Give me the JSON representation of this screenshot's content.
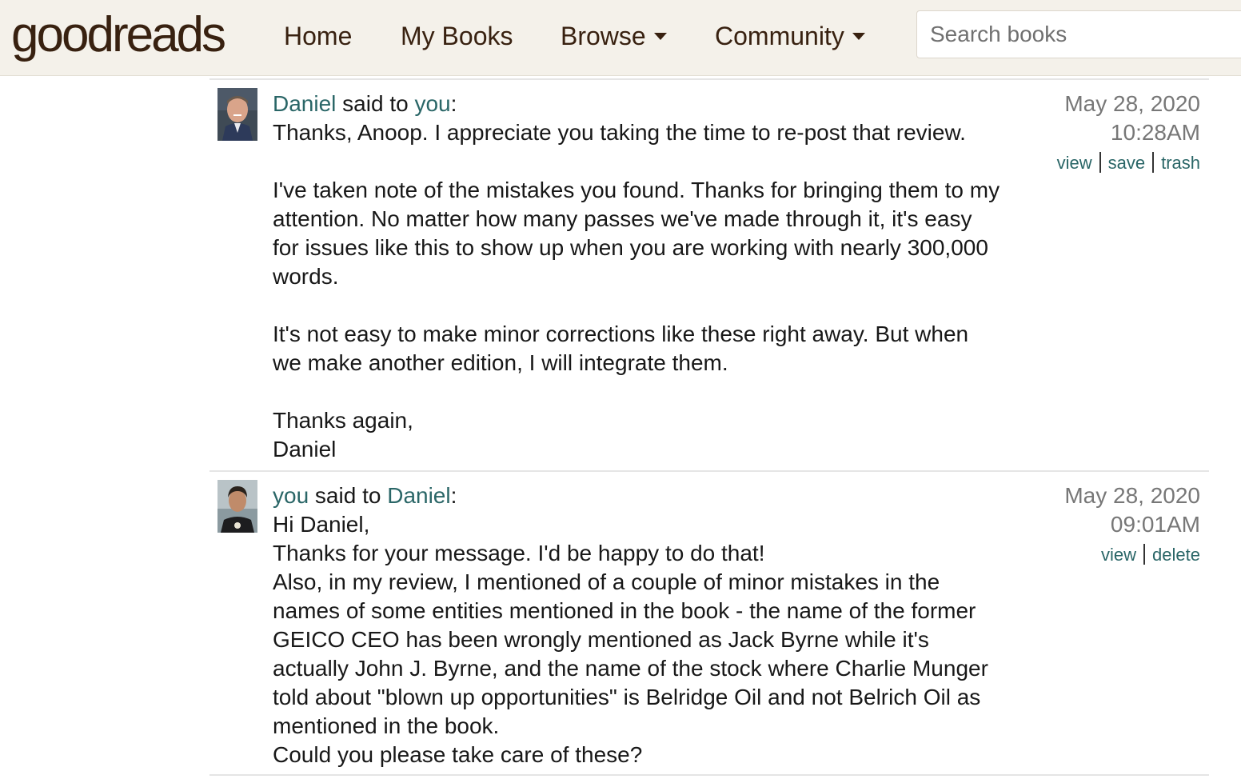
{
  "header": {
    "logo_light": "good",
    "logo_bold": "reads",
    "nav": {
      "home": "Home",
      "my_books": "My Books",
      "browse": "Browse",
      "community": "Community"
    },
    "search": {
      "placeholder": "Search books",
      "value": ""
    }
  },
  "messages": [
    {
      "from": "Daniel",
      "said_to": " said to ",
      "to": "you",
      "colon": ":",
      "date": "May 28, 2020",
      "time": "10:28AM",
      "actions": [
        "view",
        "save",
        "trash"
      ],
      "paragraphs": [
        "Thanks, Anoop. I appreciate you taking the time to re-post that review.",
        "I've taken note of the mistakes you found. Thanks for bringing them to my attention. No matter how many passes we've made through it, it's easy for issues like this to show up when you are working with nearly 300,000 words.",
        "It's not easy to make minor corrections like these right away. But when we make another edition, I will integrate them.",
        "Thanks again,",
        "Daniel"
      ]
    },
    {
      "from": "you",
      "said_to": " said to ",
      "to": "Daniel",
      "colon": ":",
      "date": "May 28, 2020",
      "time": "09:01AM",
      "actions": [
        "view",
        "delete"
      ],
      "paragraphs": [
        "Hi Daniel,",
        "Thanks for your message. I'd be happy to do that!",
        "Also, in my review, I mentioned of a couple of minor mistakes in the names of some entities mentioned in the book - the name of the former GEICO CEO has been wrongly mentioned as Jack Byrne while it's actually John J. Byrne, and the name of the stock where Charlie Munger told about \"blown up opportunities\" is Belridge Oil and not Belrich Oil as mentioned in the book.",
        "Could you please take care of these?"
      ]
    }
  ]
}
